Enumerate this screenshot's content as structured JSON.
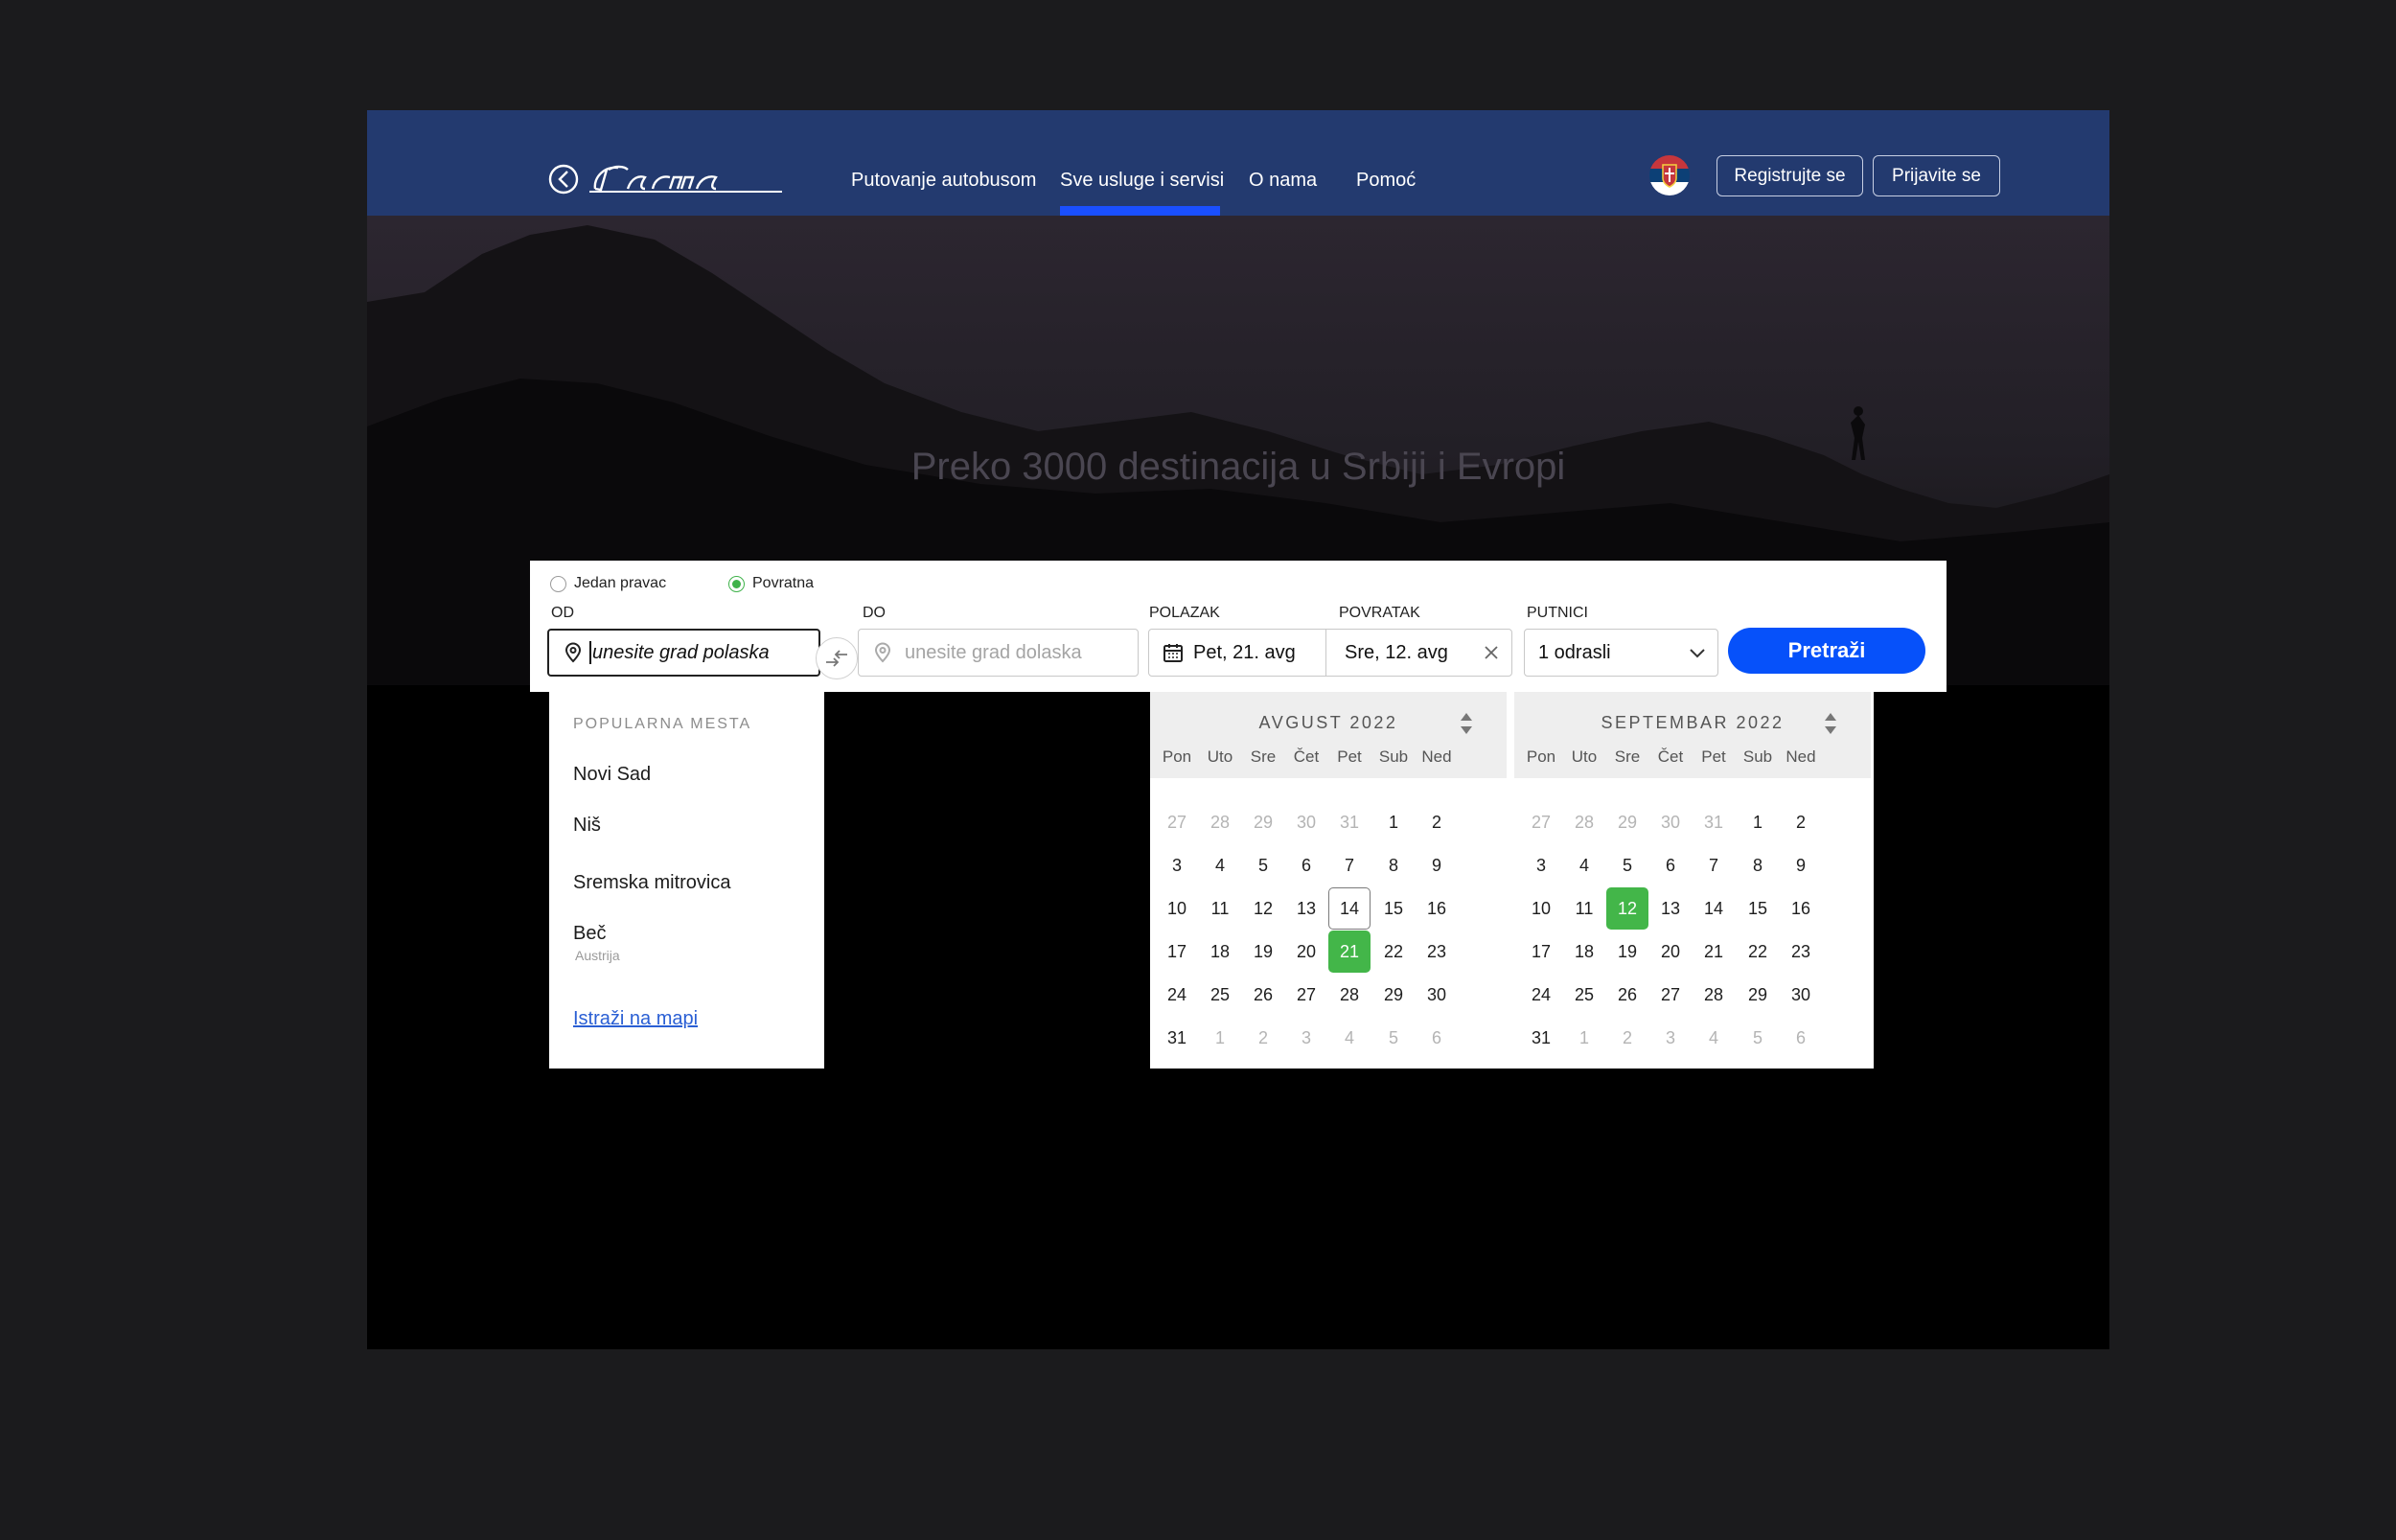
{
  "header": {
    "brand": "Lasta",
    "nav": [
      {
        "label": "Putovanje autobusom"
      },
      {
        "label": "Sve usluge i servisi",
        "active": true
      },
      {
        "label": "O nama"
      },
      {
        "label": "Pomoć"
      }
    ],
    "language_flag": "serbia-flag-icon",
    "register_label": "Registrujte se",
    "login_label": "Prijavite se",
    "accent_color": "#1a4fff",
    "bar_color": "#233a6f"
  },
  "hero": {
    "title": "Preko 3000 destinacija u Srbiji i Evropi"
  },
  "search": {
    "trip_types": [
      {
        "label": "Jedan pravac",
        "selected": false
      },
      {
        "label": "Povratna",
        "selected": true
      }
    ],
    "from": {
      "label": "OD",
      "placeholder": "unesite grad polaska"
    },
    "to": {
      "label": "DO",
      "placeholder": "unesite grad dolaska"
    },
    "departure": {
      "label": "POLAZAK",
      "value": "Pet, 21. avg"
    },
    "return": {
      "label": "POVRATAK",
      "value": "Sre, 12. avg"
    },
    "passengers": {
      "label": "PUTNICI",
      "value": "1 odrasli"
    },
    "submit_label": "Pretraži",
    "submit_color": "#0651fa"
  },
  "popular": {
    "title": "POPULARNA MESTA",
    "cities": [
      {
        "name": "Novi Sad",
        "country": ""
      },
      {
        "name": "Niš",
        "country": ""
      },
      {
        "name": "Sremska mitrovica",
        "country": ""
      },
      {
        "name": "Beč",
        "country": "Austrija"
      }
    ],
    "map_link": "Istraži na mapi"
  },
  "calendar": {
    "weekdays": [
      "Pon",
      "Uto",
      "Sre",
      "Čet",
      "Pet",
      "Sub",
      "Ned"
    ],
    "selected_color": "#43b649",
    "months": [
      {
        "title": "AVGUST 2022",
        "weeks": [
          [
            "27",
            "28",
            "29",
            "30",
            "31",
            "1",
            "2"
          ],
          [
            "3",
            "4",
            "5",
            "6",
            "7",
            "8",
            "9"
          ],
          [
            "10",
            "11",
            "12",
            "13",
            "14",
            "15",
            "16"
          ],
          [
            "17",
            "18",
            "19",
            "20",
            "21",
            "22",
            "23"
          ],
          [
            "24",
            "25",
            "26",
            "27",
            "28",
            "29",
            "30"
          ],
          [
            "31",
            "1",
            "2",
            "3",
            "4",
            "5",
            "6"
          ]
        ],
        "muted": [
          [
            0,
            0
          ],
          [
            0,
            1
          ],
          [
            0,
            2
          ],
          [
            0,
            3
          ],
          [
            0,
            4
          ],
          [
            5,
            1
          ],
          [
            5,
            2
          ],
          [
            5,
            3
          ],
          [
            5,
            4
          ],
          [
            5,
            5
          ],
          [
            5,
            6
          ]
        ],
        "today": [
          2,
          4
        ],
        "selected": [
          3,
          4
        ]
      },
      {
        "title": "SEPTEMBAR 2022",
        "weeks": [
          [
            "27",
            "28",
            "29",
            "30",
            "31",
            "1",
            "2"
          ],
          [
            "3",
            "4",
            "5",
            "6",
            "7",
            "8",
            "9"
          ],
          [
            "10",
            "11",
            "12",
            "13",
            "14",
            "15",
            "16"
          ],
          [
            "17",
            "18",
            "19",
            "20",
            "21",
            "22",
            "23"
          ],
          [
            "24",
            "25",
            "26",
            "27",
            "28",
            "29",
            "30"
          ],
          [
            "31",
            "1",
            "2",
            "3",
            "4",
            "5",
            "6"
          ]
        ],
        "muted": [
          [
            0,
            0
          ],
          [
            0,
            1
          ],
          [
            0,
            2
          ],
          [
            0,
            3
          ],
          [
            0,
            4
          ],
          [
            5,
            1
          ],
          [
            5,
            2
          ],
          [
            5,
            3
          ],
          [
            5,
            4
          ],
          [
            5,
            5
          ],
          [
            5,
            6
          ]
        ],
        "today": null,
        "selected": [
          2,
          2
        ]
      }
    ]
  }
}
